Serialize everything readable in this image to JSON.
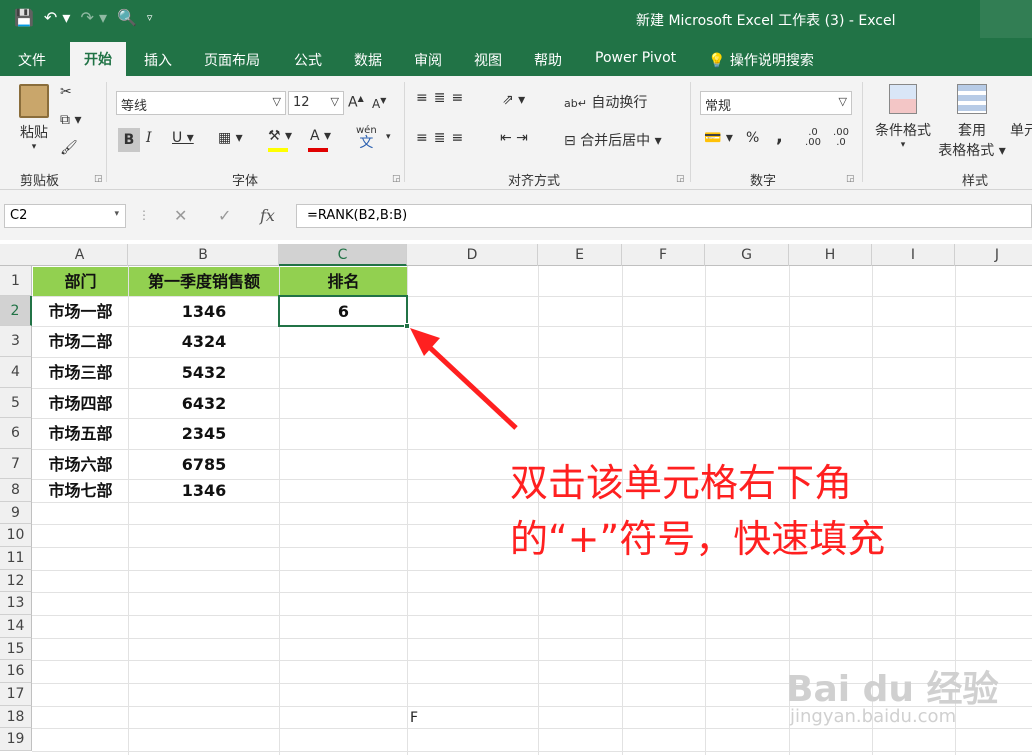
{
  "window": {
    "title": "新建 Microsoft Excel 工作表 (3)  -  Excel"
  },
  "tabs": [
    {
      "label": "文件"
    },
    {
      "label": "开始"
    },
    {
      "label": "插入"
    },
    {
      "label": "页面布局"
    },
    {
      "label": "公式"
    },
    {
      "label": "数据"
    },
    {
      "label": "审阅"
    },
    {
      "label": "视图"
    },
    {
      "label": "帮助"
    },
    {
      "label": "Power Pivot"
    },
    {
      "label": "操作说明搜索"
    }
  ],
  "ribbon": {
    "clipboard": {
      "paste": "粘贴",
      "label": "剪贴板"
    },
    "font": {
      "name": "等线",
      "size": "12",
      "label": "字体",
      "wen": "wén",
      "wen_char": "文"
    },
    "alignment": {
      "wrap": "自动换行",
      "merge": "合并后居中",
      "label": "对齐方式"
    },
    "number": {
      "format": "常规",
      "label": "数字",
      "percent": "%",
      "comma": ",",
      "inc": ".0 .00",
      "dec": ".00 .0"
    },
    "styles": {
      "conditional": "条件格式",
      "table_line1": "套用",
      "table_line2": "表格格式",
      "cell": "单元",
      "label": "样式"
    }
  },
  "formula_bar": {
    "name_box": "C2",
    "formula": "=RANK(B2,B:B)",
    "fx": "fx"
  },
  "columns": [
    "A",
    "B",
    "C",
    "D",
    "E",
    "F",
    "G",
    "H",
    "I",
    "J"
  ],
  "rows": [
    "1",
    "2",
    "3",
    "4",
    "5",
    "6",
    "7",
    "8",
    "9",
    "10",
    "11",
    "12",
    "13",
    "14",
    "15",
    "16",
    "17",
    "18",
    "19"
  ],
  "sheet": {
    "header": [
      "部门",
      "第一季度销售额",
      "排名"
    ],
    "data": [
      [
        "市场一部",
        "1346",
        "6"
      ],
      [
        "市场二部",
        "4324",
        ""
      ],
      [
        "市场三部",
        "5432",
        ""
      ],
      [
        "市场四部",
        "6432",
        ""
      ],
      [
        "市场五部",
        "2345",
        ""
      ],
      [
        "市场六部",
        "6785",
        ""
      ],
      [
        "市场七部",
        "1346",
        ""
      ]
    ],
    "stray_D18": "F"
  },
  "annotation": {
    "line1": "双击该单元格右下角",
    "line2": "的“+”符号，快速填充"
  },
  "watermark": {
    "line1": "Bai du 经验",
    "line2": "jingyan.baidu.com"
  },
  "colors": {
    "excel_green": "#217346",
    "header_fill": "#92d050",
    "annotation_red": "#ff2020"
  }
}
